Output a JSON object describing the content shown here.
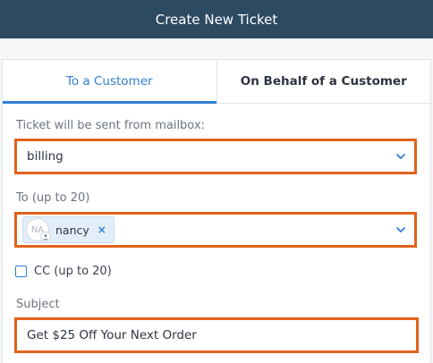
{
  "header": {
    "title": "Create New Ticket"
  },
  "tabs": [
    {
      "label": "To a Customer",
      "active": true
    },
    {
      "label": "On Behalf of a Customer",
      "active": false
    }
  ],
  "mailbox": {
    "label": "Ticket will be sent from mailbox:",
    "value": "billing"
  },
  "to": {
    "label": "To (up to 20)",
    "recipient": {
      "initials": "NA",
      "name": "nancy",
      "remove": "×"
    }
  },
  "cc": {
    "label": "CC (up to 20)",
    "checked": false
  },
  "subject": {
    "label": "Subject",
    "value": "Get $25 Off Your Next Order"
  },
  "colors": {
    "header_bg": "#2d4a63",
    "accent": "#2f7fd1",
    "highlight_border": "#e0631c"
  }
}
